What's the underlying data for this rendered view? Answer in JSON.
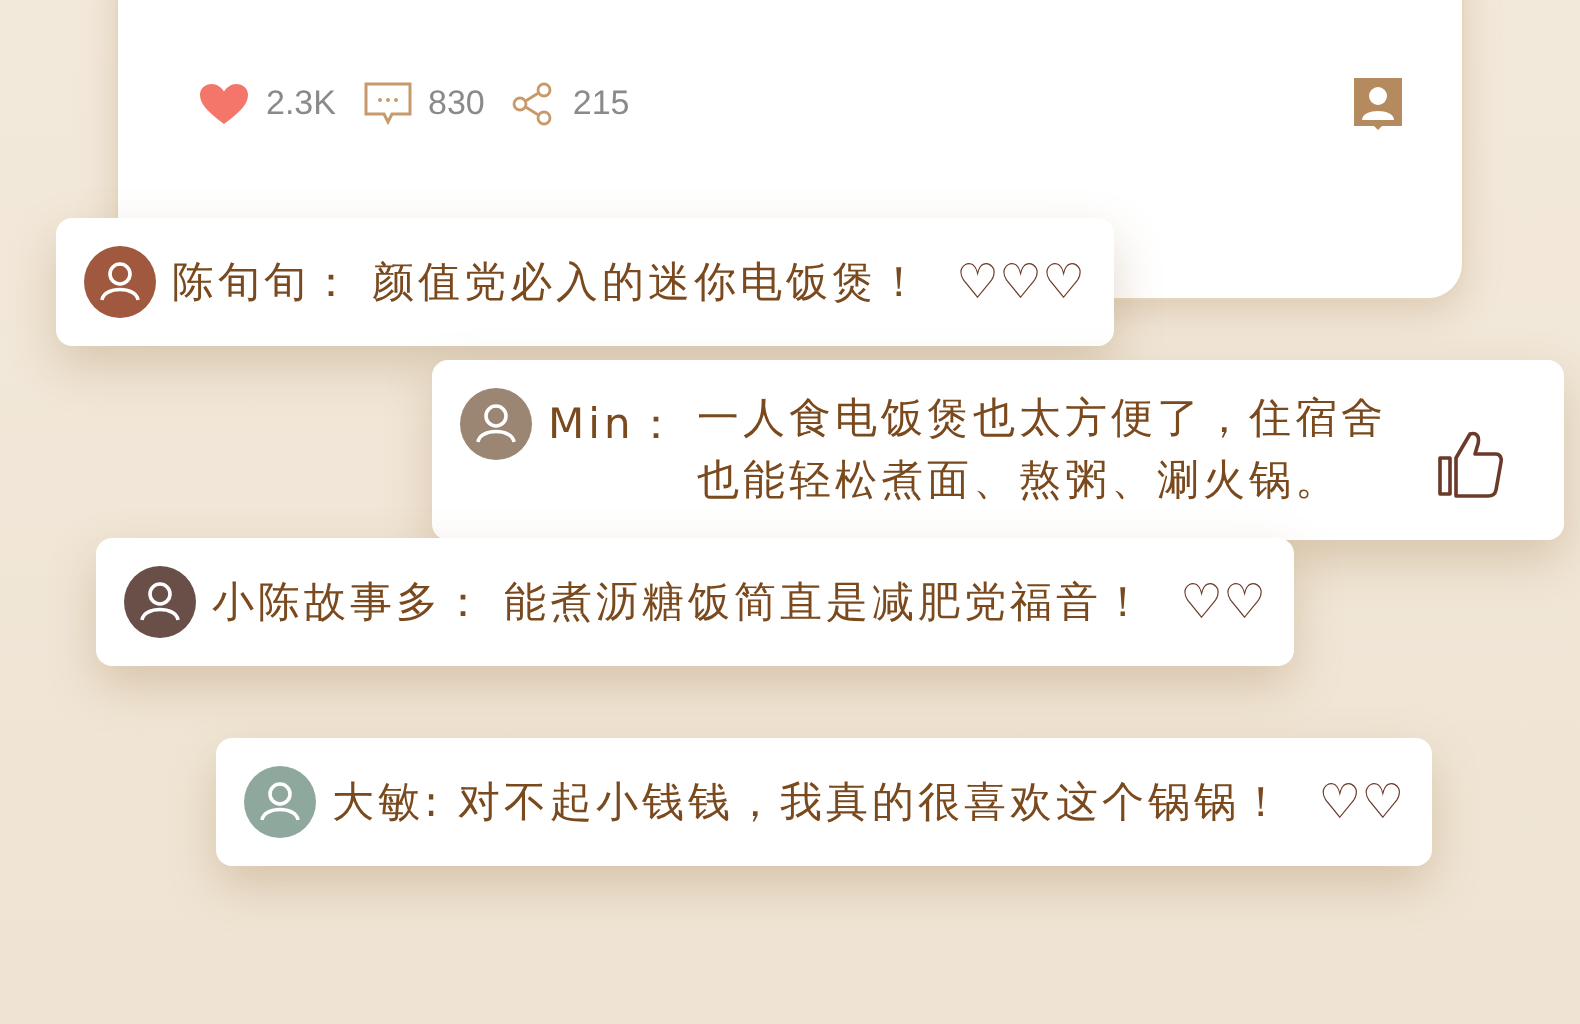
{
  "post": {
    "stats": [
      {
        "kind": "like",
        "count": "2.3K"
      },
      {
        "kind": "comment",
        "count": "830"
      },
      {
        "kind": "share",
        "count": "215"
      }
    ]
  },
  "comments": [
    {
      "name": "陈旬旬：",
      "text": "颜值党必入的迷你电饭煲！",
      "color": "#a0583e",
      "kind": "hearts",
      "reaction": "♡♡♡"
    },
    {
      "name": "Min：",
      "text": "一人食电饭煲也太方便了，住宿舍也能轻松煮面、熬粥、涮火锅。",
      "color": "#9a8672",
      "kind": "thumb"
    },
    {
      "name": "小陈故事多：",
      "text": "能煮沥糖饭简直是减肥党福音！",
      "color": "#6a4f48",
      "kind": "hearts",
      "reaction": "♡♡"
    },
    {
      "name": "大敏:",
      "text": "对不起小钱钱，我真的很喜欢这个锅锅！",
      "color": "#8fa89e",
      "kind": "hearts",
      "reaction": "♡♡"
    }
  ]
}
